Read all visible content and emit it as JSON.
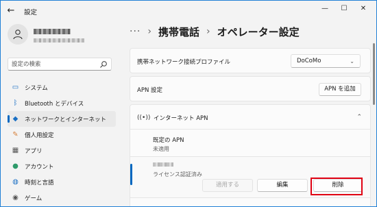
{
  "window": {
    "title": "設定"
  },
  "sidebar": {
    "search_placeholder": "設定の検索",
    "items": [
      {
        "label": "システム",
        "icon": "monitor-icon"
      },
      {
        "label": "Bluetooth とデバイス",
        "icon": "bluetooth-icon"
      },
      {
        "label": "ネットワークとインターネット",
        "icon": "network-icon",
        "active": true
      },
      {
        "label": "個人用設定",
        "icon": "brush-icon"
      },
      {
        "label": "アプリ",
        "icon": "apps-icon"
      },
      {
        "label": "アカウント",
        "icon": "account-icon"
      },
      {
        "label": "時刻と言語",
        "icon": "globe-icon"
      },
      {
        "label": "ゲーム",
        "icon": "game-icon"
      }
    ]
  },
  "breadcrumb": {
    "parent": "携帯電話",
    "current": "オペレーター設定"
  },
  "profile": {
    "label": "携帯ネットワーク接続プロファイル",
    "value": "DoCoMo"
  },
  "apn_settings": {
    "label": "APN 設定",
    "add_button": "APN を追加"
  },
  "internet_apn": {
    "title": "インターネット APN",
    "default": {
      "label": "既定の APN",
      "status": "未適用"
    },
    "entry": {
      "status": "ライセンス認証済み",
      "apply_button": "適用する",
      "edit_button": "編集",
      "delete_button": "削除"
    }
  },
  "colors": {
    "accent": "#0067c0",
    "highlight": "#e00012",
    "desktop": "#1f7fd6"
  }
}
